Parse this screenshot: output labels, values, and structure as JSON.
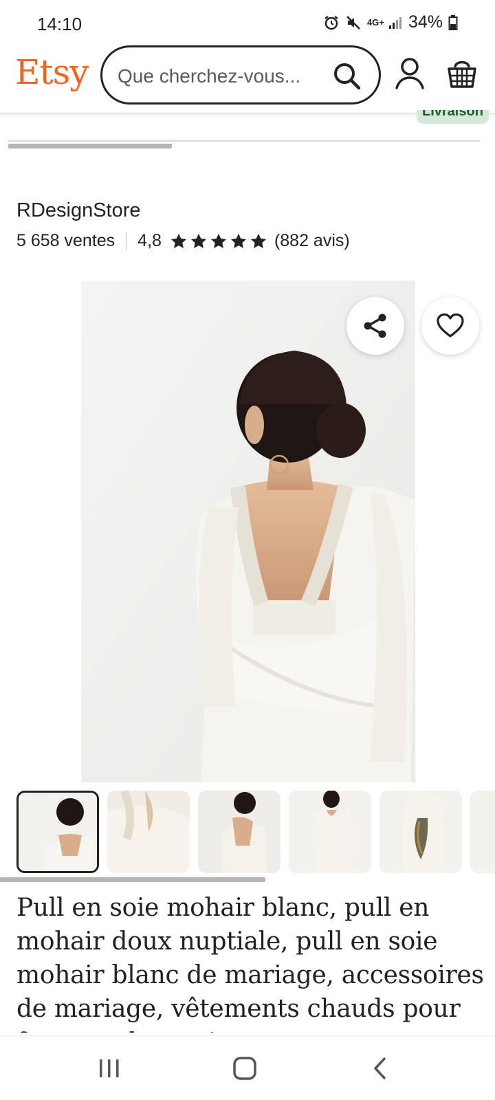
{
  "status_bar": {
    "time": "14:10",
    "network": "4G+",
    "battery": "34%"
  },
  "header": {
    "logo": "Etsy",
    "search": {
      "placeholder": "Que cherchez-vous..."
    }
  },
  "badge": {
    "label": "Livraison"
  },
  "shop": {
    "name": "RDesignStore",
    "sales": "5 658 ventes",
    "rating": "4,8",
    "stars": 5,
    "reviews": "(882 avis)"
  },
  "gallery": {
    "selected_index": 0,
    "thumbnail_count": 6
  },
  "listing": {
    "title": "Pull en soie mohair blanc, pull en mohair doux nuptiale, pull en soie mohair blanc de mariage, accessoires de mariage, vêtements chauds pour femmes de mariage"
  },
  "colors": {
    "brand": "#f1641e",
    "text": "#222222",
    "badge_bg": "#d4e9d7"
  },
  "icons": [
    "alarm-icon",
    "mute-icon",
    "signal-icon",
    "battery-icon",
    "search-icon",
    "user-icon",
    "cart-icon",
    "share-icon",
    "heart-icon",
    "star-icon",
    "recents-icon",
    "home-icon",
    "back-icon"
  ]
}
